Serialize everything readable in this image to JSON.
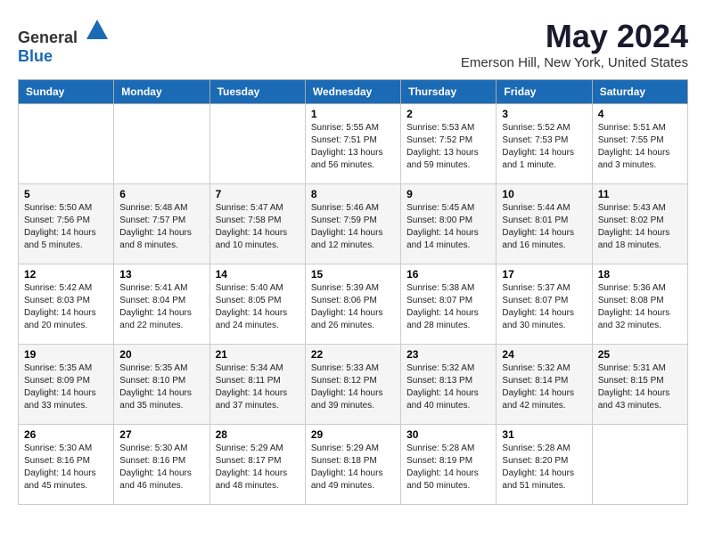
{
  "logo": {
    "text_general": "General",
    "text_blue": "Blue"
  },
  "title": {
    "month": "May 2024",
    "location": "Emerson Hill, New York, United States"
  },
  "headers": [
    "Sunday",
    "Monday",
    "Tuesday",
    "Wednesday",
    "Thursday",
    "Friday",
    "Saturday"
  ],
  "weeks": [
    [
      {
        "day": "",
        "info": ""
      },
      {
        "day": "",
        "info": ""
      },
      {
        "day": "",
        "info": ""
      },
      {
        "day": "1",
        "info": "Sunrise: 5:55 AM\nSunset: 7:51 PM\nDaylight: 13 hours\nand 56 minutes."
      },
      {
        "day": "2",
        "info": "Sunrise: 5:53 AM\nSunset: 7:52 PM\nDaylight: 13 hours\nand 59 minutes."
      },
      {
        "day": "3",
        "info": "Sunrise: 5:52 AM\nSunset: 7:53 PM\nDaylight: 14 hours\nand 1 minute."
      },
      {
        "day": "4",
        "info": "Sunrise: 5:51 AM\nSunset: 7:55 PM\nDaylight: 14 hours\nand 3 minutes."
      }
    ],
    [
      {
        "day": "5",
        "info": "Sunrise: 5:50 AM\nSunset: 7:56 PM\nDaylight: 14 hours\nand 5 minutes."
      },
      {
        "day": "6",
        "info": "Sunrise: 5:48 AM\nSunset: 7:57 PM\nDaylight: 14 hours\nand 8 minutes."
      },
      {
        "day": "7",
        "info": "Sunrise: 5:47 AM\nSunset: 7:58 PM\nDaylight: 14 hours\nand 10 minutes."
      },
      {
        "day": "8",
        "info": "Sunrise: 5:46 AM\nSunset: 7:59 PM\nDaylight: 14 hours\nand 12 minutes."
      },
      {
        "day": "9",
        "info": "Sunrise: 5:45 AM\nSunset: 8:00 PM\nDaylight: 14 hours\nand 14 minutes."
      },
      {
        "day": "10",
        "info": "Sunrise: 5:44 AM\nSunset: 8:01 PM\nDaylight: 14 hours\nand 16 minutes."
      },
      {
        "day": "11",
        "info": "Sunrise: 5:43 AM\nSunset: 8:02 PM\nDaylight: 14 hours\nand 18 minutes."
      }
    ],
    [
      {
        "day": "12",
        "info": "Sunrise: 5:42 AM\nSunset: 8:03 PM\nDaylight: 14 hours\nand 20 minutes."
      },
      {
        "day": "13",
        "info": "Sunrise: 5:41 AM\nSunset: 8:04 PM\nDaylight: 14 hours\nand 22 minutes."
      },
      {
        "day": "14",
        "info": "Sunrise: 5:40 AM\nSunset: 8:05 PM\nDaylight: 14 hours\nand 24 minutes."
      },
      {
        "day": "15",
        "info": "Sunrise: 5:39 AM\nSunset: 8:06 PM\nDaylight: 14 hours\nand 26 minutes."
      },
      {
        "day": "16",
        "info": "Sunrise: 5:38 AM\nSunset: 8:07 PM\nDaylight: 14 hours\nand 28 minutes."
      },
      {
        "day": "17",
        "info": "Sunrise: 5:37 AM\nSunset: 8:07 PM\nDaylight: 14 hours\nand 30 minutes."
      },
      {
        "day": "18",
        "info": "Sunrise: 5:36 AM\nSunset: 8:08 PM\nDaylight: 14 hours\nand 32 minutes."
      }
    ],
    [
      {
        "day": "19",
        "info": "Sunrise: 5:35 AM\nSunset: 8:09 PM\nDaylight: 14 hours\nand 33 minutes."
      },
      {
        "day": "20",
        "info": "Sunrise: 5:35 AM\nSunset: 8:10 PM\nDaylight: 14 hours\nand 35 minutes."
      },
      {
        "day": "21",
        "info": "Sunrise: 5:34 AM\nSunset: 8:11 PM\nDaylight: 14 hours\nand 37 minutes."
      },
      {
        "day": "22",
        "info": "Sunrise: 5:33 AM\nSunset: 8:12 PM\nDaylight: 14 hours\nand 39 minutes."
      },
      {
        "day": "23",
        "info": "Sunrise: 5:32 AM\nSunset: 8:13 PM\nDaylight: 14 hours\nand 40 minutes."
      },
      {
        "day": "24",
        "info": "Sunrise: 5:32 AM\nSunset: 8:14 PM\nDaylight: 14 hours\nand 42 minutes."
      },
      {
        "day": "25",
        "info": "Sunrise: 5:31 AM\nSunset: 8:15 PM\nDaylight: 14 hours\nand 43 minutes."
      }
    ],
    [
      {
        "day": "26",
        "info": "Sunrise: 5:30 AM\nSunset: 8:16 PM\nDaylight: 14 hours\nand 45 minutes."
      },
      {
        "day": "27",
        "info": "Sunrise: 5:30 AM\nSunset: 8:16 PM\nDaylight: 14 hours\nand 46 minutes."
      },
      {
        "day": "28",
        "info": "Sunrise: 5:29 AM\nSunset: 8:17 PM\nDaylight: 14 hours\nand 48 minutes."
      },
      {
        "day": "29",
        "info": "Sunrise: 5:29 AM\nSunset: 8:18 PM\nDaylight: 14 hours\nand 49 minutes."
      },
      {
        "day": "30",
        "info": "Sunrise: 5:28 AM\nSunset: 8:19 PM\nDaylight: 14 hours\nand 50 minutes."
      },
      {
        "day": "31",
        "info": "Sunrise: 5:28 AM\nSunset: 8:20 PM\nDaylight: 14 hours\nand 51 minutes."
      },
      {
        "day": "",
        "info": ""
      }
    ]
  ]
}
